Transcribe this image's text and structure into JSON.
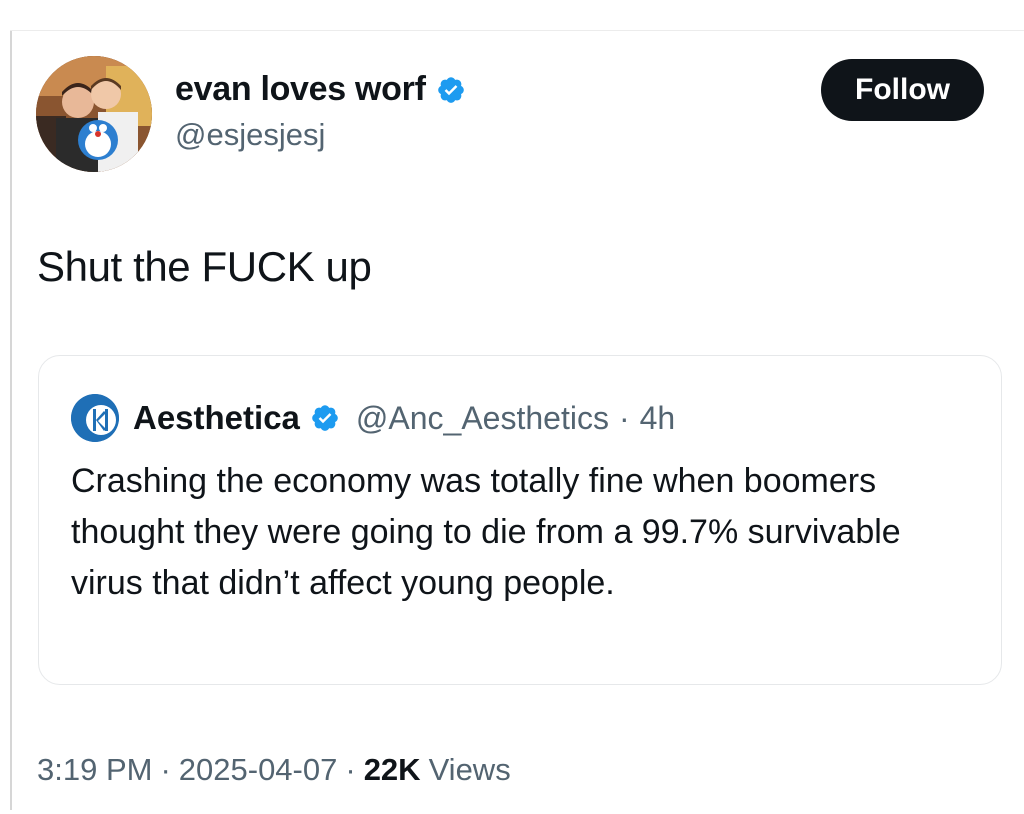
{
  "author": {
    "display_name": "evan loves worf",
    "handle": "@esjesjesj",
    "verified_icon": "verified-badge-icon",
    "avatar_icon": "user-avatar"
  },
  "follow_button": {
    "label": "Follow"
  },
  "tweet": {
    "text": "Shut the FUCK up"
  },
  "quoted_tweet": {
    "display_name": "Aesthetica",
    "handle": "@Anc_Aesthetics",
    "separator": "·",
    "time": "4h",
    "verified_icon": "verified-badge-icon",
    "avatar_icon": "aesthetica-logo",
    "text": "Crashing the economy was totally fine when boomers thought they were going to die from a 99.7% survivable virus that didn’t affect young people."
  },
  "meta": {
    "time": "3:19 PM",
    "sep1": "·",
    "date": "2025-04-07",
    "sep2": "·",
    "views_count": "22K",
    "views_label": "Views"
  },
  "colors": {
    "text_primary": "#0f1419",
    "text_secondary": "#536471",
    "verified_blue": "#1d9bf0",
    "button_bg": "#0f1419",
    "card_border": "#e6e8ea"
  }
}
